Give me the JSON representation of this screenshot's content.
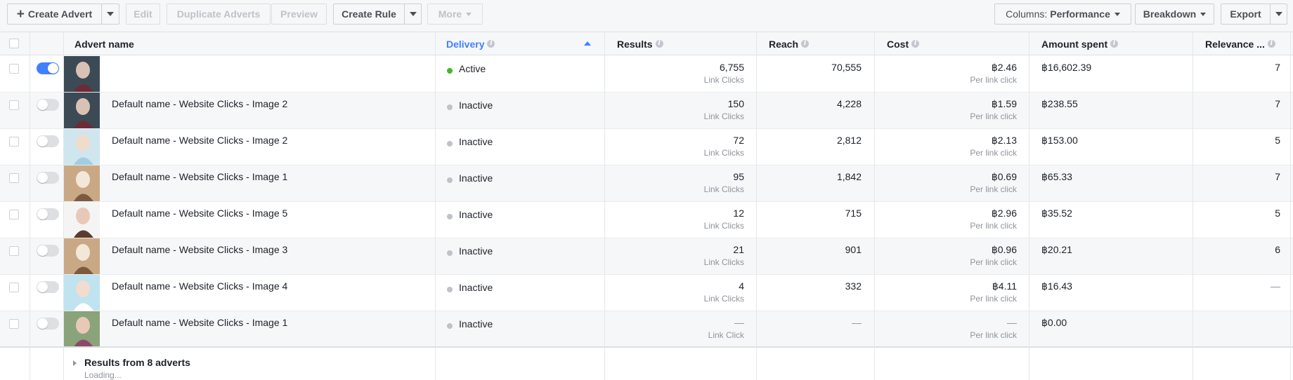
{
  "toolbar": {
    "create_advert": "Create Advert",
    "edit": "Edit",
    "duplicate": "Duplicate Adverts",
    "preview": "Preview",
    "create_rule": "Create Rule",
    "more": "More",
    "columns_label": "Columns:",
    "columns_value": "Performance",
    "breakdown": "Breakdown",
    "export": "Export"
  },
  "columns": {
    "advert_name": "Advert name",
    "delivery": "Delivery",
    "results": "Results",
    "reach": "Reach",
    "cost": "Cost",
    "amount_spent": "Amount spent",
    "relevance": "Relevance ..."
  },
  "icons": {
    "info": "info-icon",
    "plus": "plus-icon",
    "caret": "chevron-down-icon",
    "sort": "sort-ascending-icon"
  },
  "colors": {
    "accent": "#4080ff",
    "active_status": "#42b72a",
    "inactive_status": "#bec2c9"
  },
  "rows": [
    {
      "name": "",
      "enabled": true,
      "delivery": "Active",
      "results": "6,755",
      "results_unit": "Link Clicks",
      "reach": "70,555",
      "cost": "฿2.46",
      "cost_unit": "Per link click",
      "spent": "฿16,602.39",
      "relevance": "7",
      "thumb": "thumb-a"
    },
    {
      "name": "Default name - Website Clicks - Image 2",
      "enabled": false,
      "delivery": "Inactive",
      "results": "150",
      "results_unit": "Link Clicks",
      "reach": "4,228",
      "cost": "฿1.59",
      "cost_unit": "Per link click",
      "spent": "฿238.55",
      "relevance": "7",
      "thumb": "thumb-a"
    },
    {
      "name": "Default name - Website Clicks - Image 2",
      "enabled": false,
      "delivery": "Inactive",
      "results": "72",
      "results_unit": "Link Clicks",
      "reach": "2,812",
      "cost": "฿2.13",
      "cost_unit": "Per link click",
      "spent": "฿153.00",
      "relevance": "5",
      "thumb": "thumb-b"
    },
    {
      "name": "Default name - Website Clicks - Image 1",
      "enabled": false,
      "delivery": "Inactive",
      "results": "95",
      "results_unit": "Link Clicks",
      "reach": "1,842",
      "cost": "฿0.69",
      "cost_unit": "Per link click",
      "spent": "฿65.33",
      "relevance": "7",
      "thumb": "thumb-c"
    },
    {
      "name": "Default name - Website Clicks - Image 5",
      "enabled": false,
      "delivery": "Inactive",
      "results": "12",
      "results_unit": "Link Clicks",
      "reach": "715",
      "cost": "฿2.96",
      "cost_unit": "Per link click",
      "spent": "฿35.52",
      "relevance": "5",
      "thumb": "thumb-d"
    },
    {
      "name": "Default name - Website Clicks - Image 3",
      "enabled": false,
      "delivery": "Inactive",
      "results": "21",
      "results_unit": "Link Clicks",
      "reach": "901",
      "cost": "฿0.96",
      "cost_unit": "Per link click",
      "spent": "฿20.21",
      "relevance": "6",
      "thumb": "thumb-c"
    },
    {
      "name": "Default name - Website Clicks - Image 4",
      "enabled": false,
      "delivery": "Inactive",
      "results": "4",
      "results_unit": "Link Clicks",
      "reach": "332",
      "cost": "฿4.11",
      "cost_unit": "Per link click",
      "spent": "฿16.43",
      "relevance": "—",
      "thumb": "thumb-e"
    },
    {
      "name": "Default name - Website Clicks - Image 1",
      "enabled": false,
      "delivery": "Inactive",
      "results": "—",
      "results_unit": "Link Click",
      "reach": "—",
      "cost": "—",
      "cost_unit": "Per link click",
      "spent": "฿0.00",
      "relevance": "",
      "thumb": "thumb-f"
    }
  ],
  "footer": {
    "title": "Results from 8 adverts",
    "loading": "Loading..."
  }
}
